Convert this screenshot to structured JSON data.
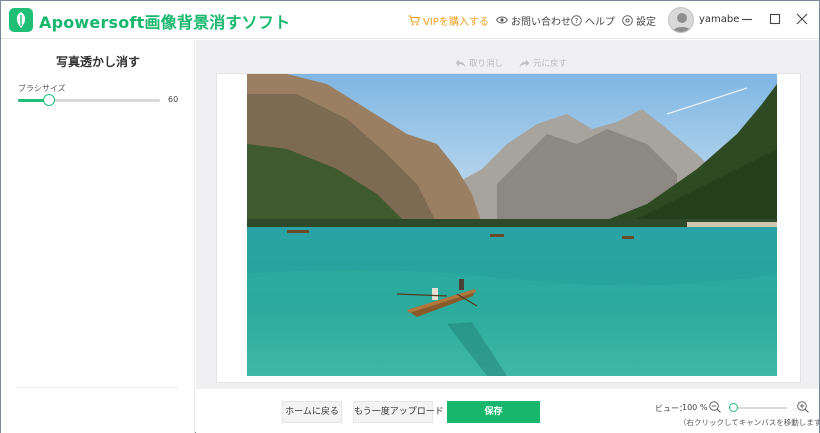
{
  "app": {
    "title": "Apowersoft画像背景消すソフト",
    "brand_color": "#1fbf77"
  },
  "titlebar": {
    "vip_label": "VIPを購入する",
    "contact_label": "お問い合わせ",
    "help_label": "ヘルプ",
    "settings_label": "設定",
    "username": "yamabe"
  },
  "left_panel": {
    "title": "写真透かし消す",
    "brush_size_label": "ブラシサイズ",
    "brush_size_value": "60",
    "brush_size_fraction": 0.22
  },
  "canvas": {
    "undo_label": "取り消し",
    "redo_label": "元に戻す",
    "image_description_icon": "photo-lake-boat"
  },
  "bottom": {
    "home_label": "ホームに戻る",
    "reupload_label": "もう一度アップロード",
    "save_label": "保存",
    "view_label": "ビュー：",
    "zoom_value": "100 %",
    "zoom_fraction": 0.0,
    "hint": "（右クリックしてキャンバスを移動します）"
  }
}
